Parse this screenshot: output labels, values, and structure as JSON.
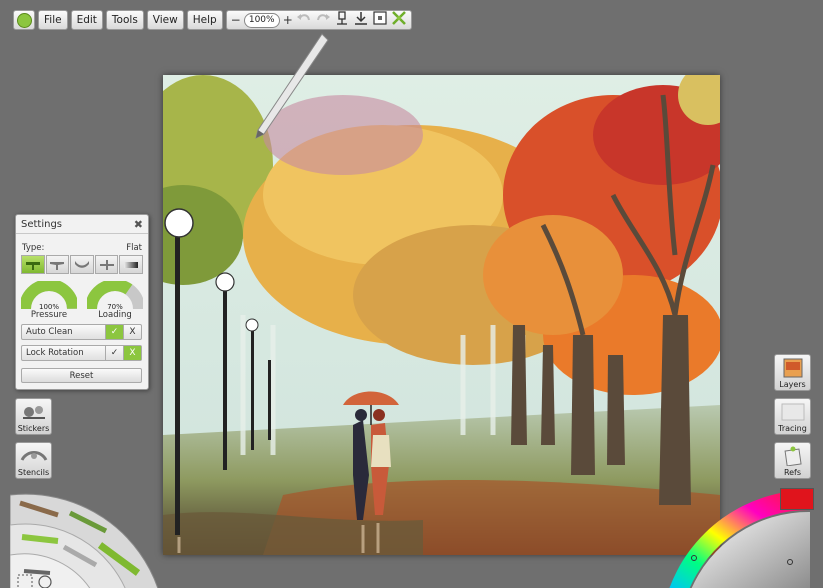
{
  "menubar": {
    "logo_icon": "artrage-logo-icon",
    "items": [
      "File",
      "Edit",
      "Tools",
      "View",
      "Help"
    ],
    "zoom_minus": "−",
    "zoom_value": "100%",
    "zoom_plus": "+",
    "tool_icons": [
      "undo-icon",
      "redo-icon",
      "reference-pin-icon",
      "import-icon",
      "canvas-icon",
      "fullscreen-icon"
    ]
  },
  "settings": {
    "title": "Settings",
    "type_label": "Type:",
    "type_value": "Flat",
    "pressure_value": "100%",
    "pressure_fraction": 1.0,
    "pressure_label": "Pressure",
    "loading_value": "70%",
    "loading_fraction": 0.7,
    "loading_label": "Loading",
    "auto_clean_label": "Auto Clean",
    "auto_clean_on": "✓",
    "auto_clean_off": "X",
    "lock_rotation_label": "Lock Rotation",
    "lock_rotation_on": "✓",
    "lock_rotation_off": "X",
    "reset_label": "Reset"
  },
  "left_tools": {
    "stickers_label": "Stickers",
    "stencils_label": "Stencils"
  },
  "right_tools": {
    "layers_label": "Layers",
    "tracing_label": "Tracing",
    "refs_label": "Refs"
  },
  "colors": {
    "accent": "#8cc63f",
    "background": "#6f6f6f",
    "current_color": "#e0141c"
  }
}
